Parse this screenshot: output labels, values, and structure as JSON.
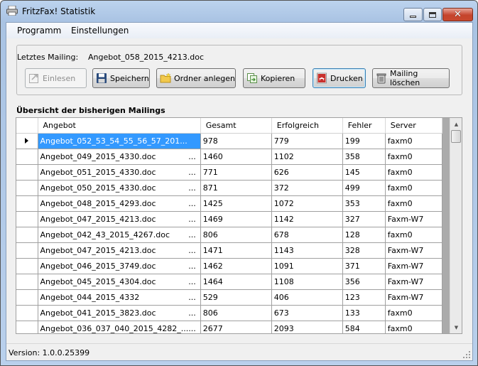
{
  "window": {
    "title": "FritzFax! Statistik"
  },
  "menu": {
    "items": [
      "Programm",
      "Einstellungen"
    ]
  },
  "mailing": {
    "label": "Letztes Mailing:",
    "value": "Angebot_058_2015_4213.doc"
  },
  "buttons": {
    "einlesen": "Einlesen",
    "speichern": "Speichern",
    "ordner": "Ordner anlegen",
    "kopieren": "Kopieren",
    "drucken": "Drucken",
    "loeschen": "Mailing löschen"
  },
  "section": {
    "title": "Übersicht der bisherigen Mailings"
  },
  "table": {
    "headers": [
      "Angebot",
      "Gesamt",
      "Erfolgreich",
      "Fehler",
      "Server"
    ],
    "rows": [
      [
        "Angebot_052_53_54_55_56_57_201...",
        "978",
        "779",
        "199",
        "faxm0"
      ],
      [
        "Angebot_049_2015_4330.doc",
        "1460",
        "1102",
        "358",
        "faxm0"
      ],
      [
        "Angebot_051_2015_4330.doc",
        "771",
        "626",
        "145",
        "faxm0"
      ],
      [
        "Angebot_050_2015_4330.doc",
        "871",
        "372",
        "499",
        "faxm0"
      ],
      [
        "Angebot_048_2015_4293.doc",
        "1425",
        "1072",
        "353",
        "faxm0"
      ],
      [
        "Angebot_047_2015_4213.doc",
        "1469",
        "1142",
        "327",
        "Faxm-W7"
      ],
      [
        "Angebot_042_43_2015_4267.doc",
        "806",
        "678",
        "128",
        "faxm0"
      ],
      [
        "Angebot_047_2015_4213.doc",
        "1471",
        "1143",
        "328",
        "Faxm-W7"
      ],
      [
        "Angebot_046_2015_3749.doc",
        "1462",
        "1091",
        "371",
        "Faxm-W7"
      ],
      [
        "Angebot_045_2015_4304.doc",
        "1464",
        "1108",
        "356",
        "Faxm-W7"
      ],
      [
        "Angebot_044_2015_4332",
        "529",
        "406",
        "123",
        "Faxm-W7"
      ],
      [
        "Angebot_041_2015_3823.doc",
        "806",
        "673",
        "133",
        "faxm0"
      ],
      [
        "Angebot_036_037_040_2015_4282_...",
        "2677",
        "2093",
        "584",
        "faxm0"
      ]
    ],
    "selected_row": 0
  },
  "status": {
    "version": "Version: 1.0.0.25399"
  },
  "colors": {
    "selection": "#3399ff",
    "title_bar": "#b9d0ec",
    "close": "#c5432c"
  }
}
